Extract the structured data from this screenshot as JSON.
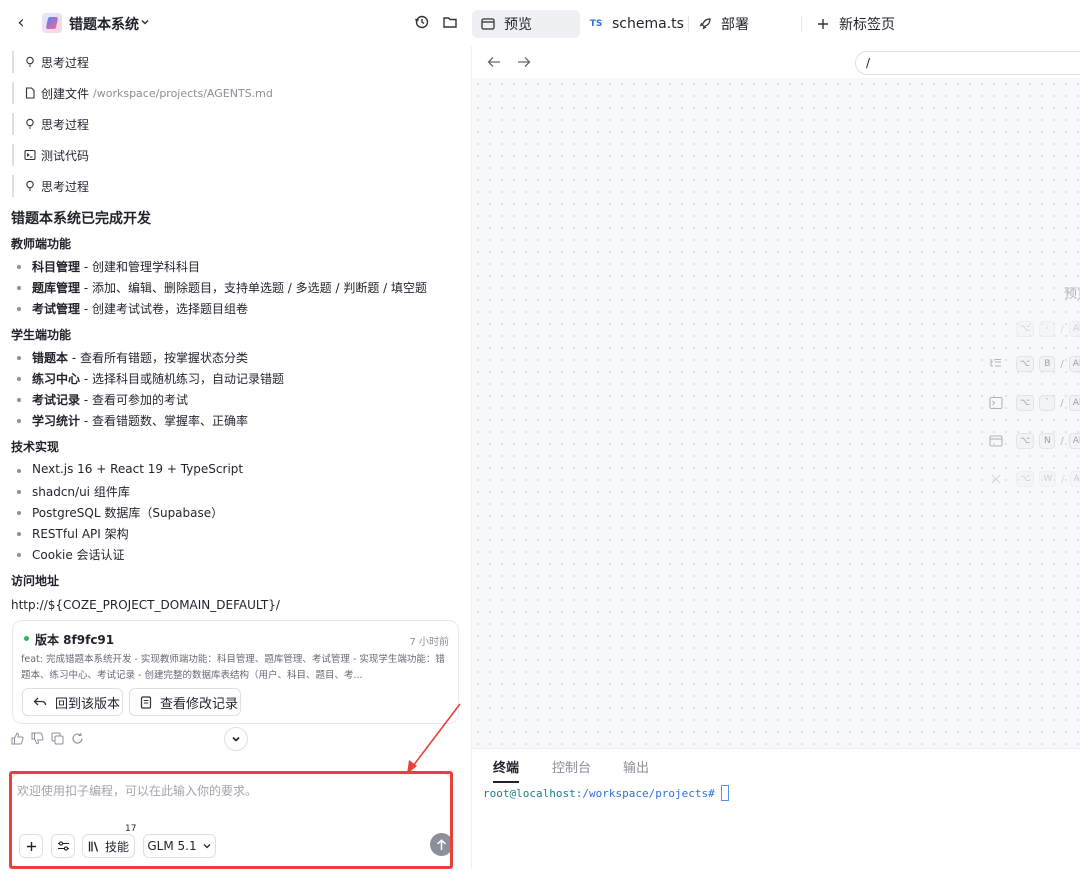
{
  "topbar": {
    "app_title": "错题本系统",
    "tabs": [
      {
        "label": "预览",
        "icon": "preview-window-icon",
        "active": true
      },
      {
        "label": "schema.ts",
        "icon": "typescript-file-icon",
        "badge": "TS",
        "active": false
      },
      {
        "label": "部署",
        "icon": "rocket-icon",
        "active": false
      },
      {
        "label": "新标签页",
        "icon": "plus-icon",
        "active": false
      }
    ]
  },
  "chat": {
    "steps": [
      {
        "label": "思考过程",
        "icon": "lightbulb-icon"
      },
      {
        "label": "创建文件",
        "path": "/workspace/projects/AGENTS.md",
        "icon": "file-icon"
      },
      {
        "label": "思考过程",
        "icon": "lightbulb-icon"
      },
      {
        "label": "测试代码",
        "icon": "terminal-icon"
      },
      {
        "label": "思考过程",
        "icon": "lightbulb-icon"
      }
    ],
    "title": "错题本系统已完成开发",
    "sections": [
      {
        "heading": "教师端功能",
        "items": [
          {
            "bold": "科目管理",
            "text": " - 创建和管理学科科目"
          },
          {
            "bold": "题库管理",
            "text": " - 添加、编辑、删除题目，支持单选题 / 多选题 / 判断题 / 填空题"
          },
          {
            "bold": "考试管理",
            "text": " - 创建考试试卷，选择题目组卷"
          }
        ]
      },
      {
        "heading": "学生端功能",
        "items": [
          {
            "bold": "错题本",
            "text": " - 查看所有错题，按掌握状态分类"
          },
          {
            "bold": "练习中心",
            "text": " - 选择科目或随机练习，自动记录错题"
          },
          {
            "bold": "考试记录",
            "text": " - 查看可参加的考试"
          },
          {
            "bold": "学习统计",
            "text": " - 查看错题数、掌握率、正确率"
          }
        ]
      },
      {
        "heading": "技术实现",
        "items": [
          {
            "bold": "",
            "text": "Next.js 16 + React 19 + TypeScript"
          },
          {
            "bold": "",
            "text": "shadcn/ui 组件库"
          },
          {
            "bold": "",
            "text": "PostgreSQL 数据库（Supabase）"
          },
          {
            "bold": "",
            "text": "RESTful API 架构"
          },
          {
            "bold": "",
            "text": "Cookie 会话认证"
          }
        ]
      }
    ],
    "access_heading": "访问地址",
    "access_url": "http://${COZE_PROJECT_DOMAIN_DEFAULT}/",
    "version_card": {
      "title": "版本 8f9fc91",
      "time": "7 小时前",
      "description": "feat: 完成错题本系统开发 - 实现教师端功能：科目管理、题库管理、考试管理 - 实现学生端功能：错题本、练习中心、考试记录 - 创建完整的数据库表结构（用户、科目、题目、考...",
      "revert_label": "回到该版本",
      "history_label": "查看修改记录"
    },
    "input": {
      "placeholder": "欢迎使用扣子编程，可以在此输入你的要求。",
      "skills_label": "技能",
      "skills_count": "17",
      "model_label": "GLM 5.1"
    }
  },
  "right": {
    "address": "/",
    "preview_label": "预览",
    "shortcuts": [
      {
        "icon": "list-tree-icon",
        "keys": [
          "⌥",
          "B"
        ],
        "tail": "Al"
      },
      {
        "icon": "terminal-icon",
        "keys": [
          "⌥",
          "`"
        ],
        "tail": "Al"
      },
      {
        "icon": "window-icon",
        "keys": [
          "⌥",
          "N"
        ],
        "tail": "Al"
      }
    ],
    "terminal": {
      "tabs": [
        "终端",
        "控制台",
        "输出"
      ],
      "prompt": "root@localhost",
      "cwd": ":/workspace/projects#"
    }
  },
  "colors": {
    "annotation_red": "#e8403b",
    "version_dot": "#2fb35b",
    "terminal_blue": "#2f6fde"
  }
}
